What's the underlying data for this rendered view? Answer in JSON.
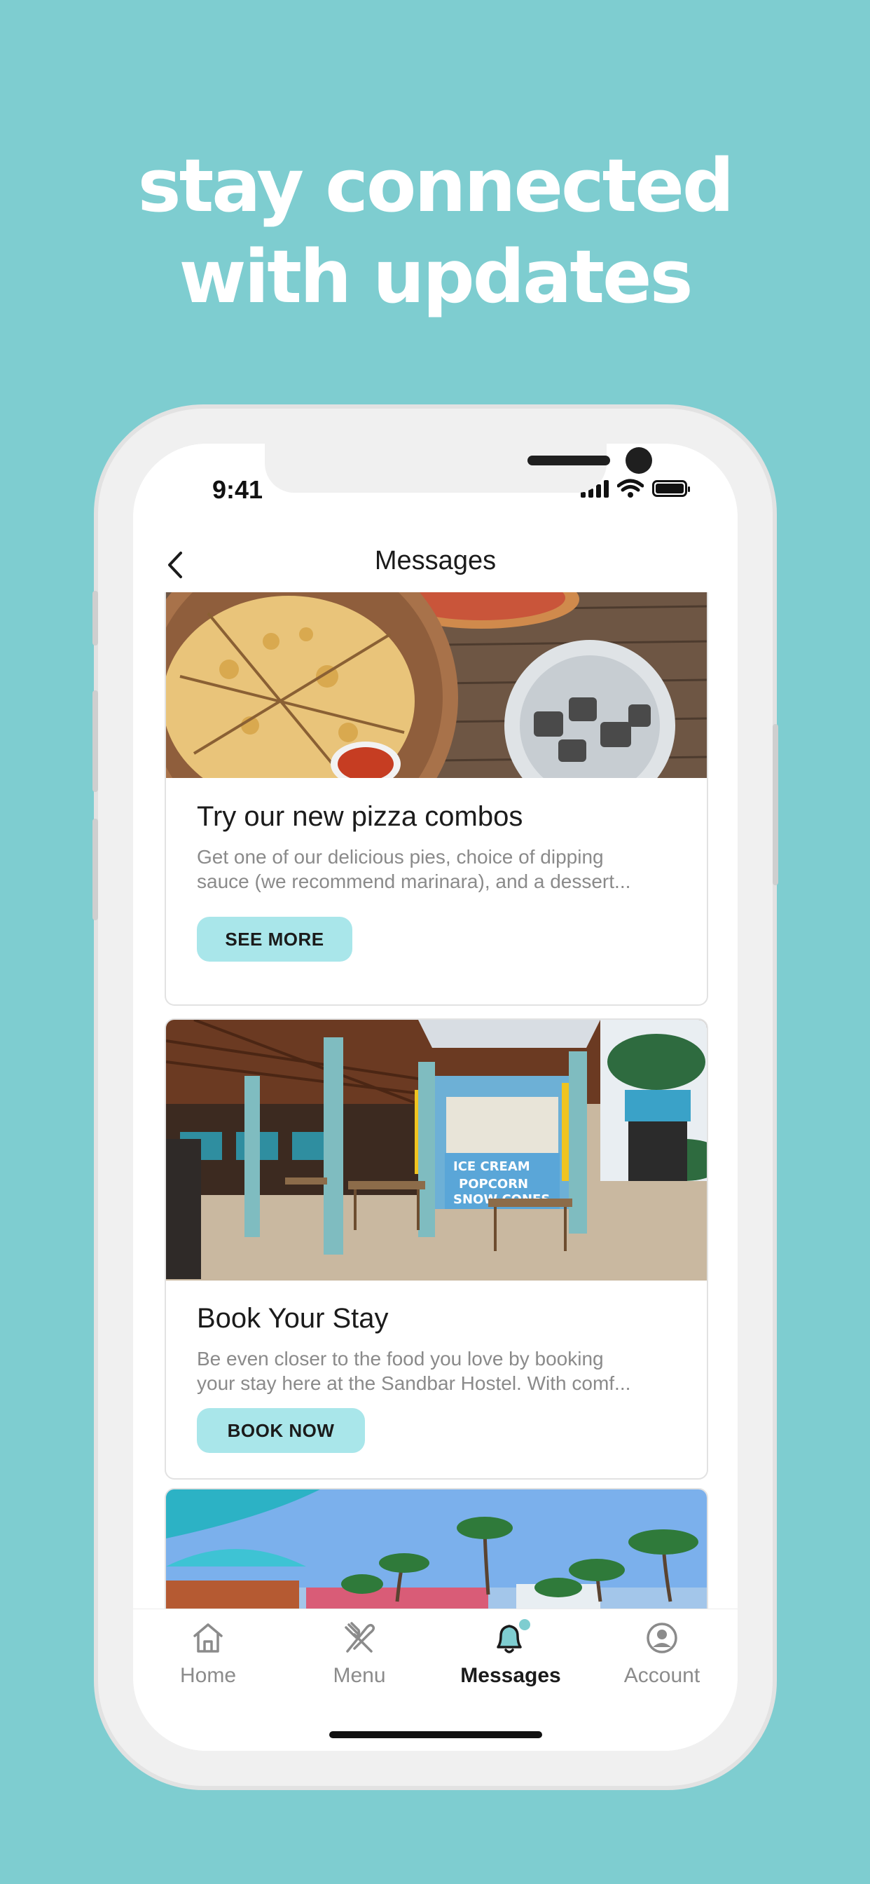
{
  "headline": {
    "line1": "stay connected",
    "line2": "with updates"
  },
  "status_bar": {
    "time": "9:41"
  },
  "header": {
    "title": "Messages"
  },
  "messages": [
    {
      "title": "Try our new pizza combos",
      "body_line1": "Get one of our delicious pies, choice of dipping",
      "body_line2": "sauce (we recommend marinara), and a dessert...",
      "button": "SEE MORE"
    },
    {
      "title": "Book Your Stay",
      "body_line1": "Be even closer to the food you love by booking",
      "body_line2": "your stay here at the Sandbar Hostel. With comf...",
      "button": "BOOK NOW"
    },
    {
      "title": "",
      "body_line1": "",
      "body_line2": "",
      "button": ""
    }
  ],
  "tabbar": {
    "items": [
      {
        "label": "Home",
        "icon": "home-icon"
      },
      {
        "label": "Menu",
        "icon": "fork-knife-icon"
      },
      {
        "label": "Messages",
        "icon": "bell-icon",
        "active": true,
        "has_badge": true
      },
      {
        "label": "Account",
        "icon": "user-circle-icon"
      }
    ]
  },
  "colors": {
    "background": "#7ecdd0",
    "button": "#a9e6ea",
    "badge": "#7ecdd0",
    "text": "#1b1b1b",
    "muted": "#8a8a8a"
  }
}
